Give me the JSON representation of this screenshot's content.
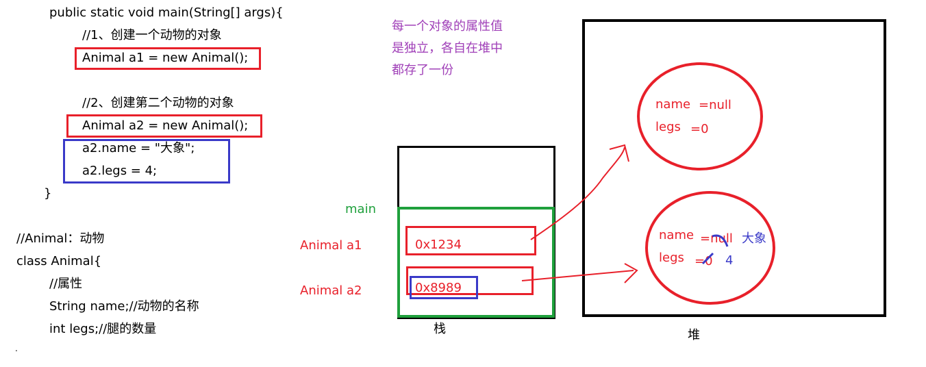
{
  "code": {
    "main_sig": "public static void main(String[] args){",
    "comment1": "//1、创建一个动物的对象",
    "line_a1": "Animal a1 = new Animal();",
    "comment2": "//2、创建第二个动物的对象",
    "line_a2": "Animal a2 = new Animal();",
    "line_name": "a2.name = \"大象\";",
    "line_legs": "a2.legs = 4;",
    "close_brace": "}",
    "class_comment": "//Animal：动物",
    "class_decl": "class Animal{",
    "attr_comment": "//属性",
    "field_name": "String name;//动物的名称",
    "field_legs": "int legs;//腿的数量",
    "trailing": "."
  },
  "note": {
    "line1": "每一个对象的属性值",
    "line2": "是独立，各自在堆中",
    "line3": "都存了一份"
  },
  "stack": {
    "frame_label": "main",
    "var_a1": "Animal a1",
    "var_a2": "Animal a2",
    "addr_a1": "0x1234",
    "addr_a2": "0x8989",
    "caption": "栈"
  },
  "heap": {
    "caption": "堆",
    "obj1": {
      "name_label": "name",
      "name_value": "=null",
      "legs_label": "legs",
      "legs_value": "=0"
    },
    "obj2": {
      "name_label": "name",
      "name_value": "=null",
      "legs_label": "legs",
      "legs_value": "=0",
      "name_new": "大象",
      "legs_new": "4"
    }
  },
  "colors": {
    "red": "#e8202a",
    "blue": "#3a3ac8",
    "green": "#1fa03c",
    "purple": "#a040b8",
    "black": "#000000"
  }
}
